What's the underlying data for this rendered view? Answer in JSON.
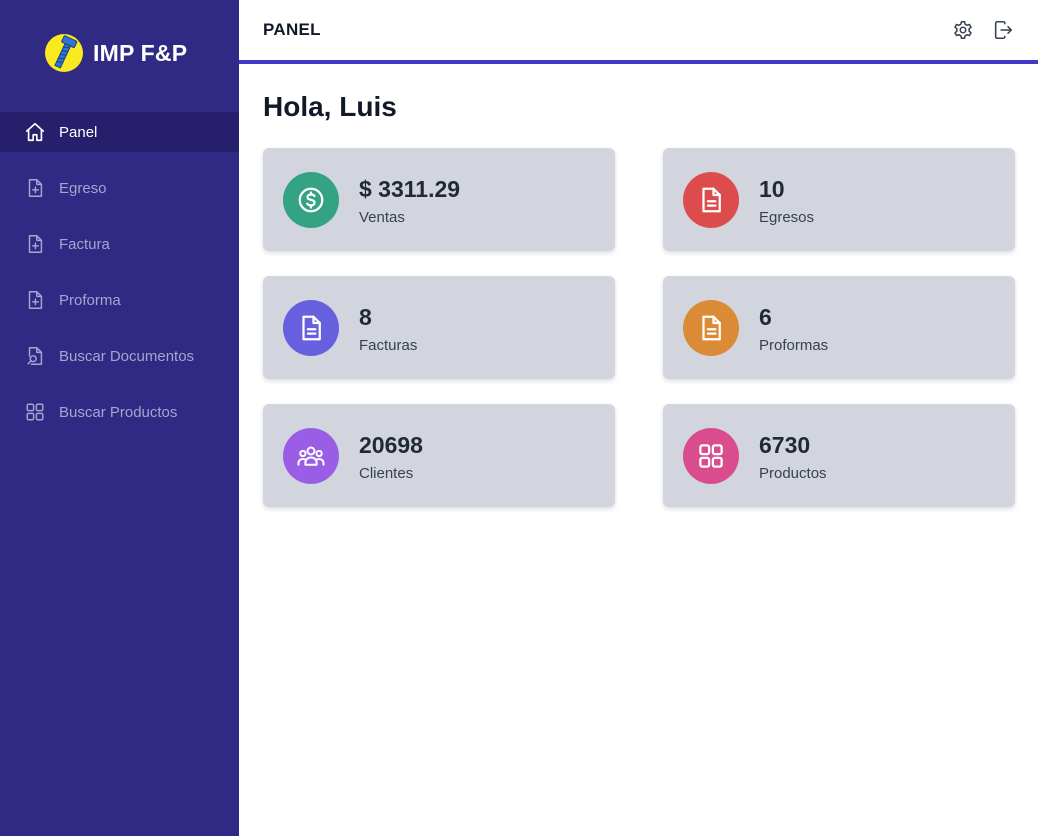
{
  "brand": {
    "name": "IMP F&P"
  },
  "sidebar": {
    "items": [
      {
        "label": "Panel",
        "icon": "home-icon"
      },
      {
        "label": "Egreso",
        "icon": "document-plus-icon"
      },
      {
        "label": "Factura",
        "icon": "document-plus-icon"
      },
      {
        "label": "Proforma",
        "icon": "document-plus-icon"
      },
      {
        "label": "Buscar Documentos",
        "icon": "document-search-icon"
      },
      {
        "label": "Buscar Productos",
        "icon": "grid-icon"
      }
    ]
  },
  "header": {
    "title": "PANEL",
    "icons": [
      "gear-icon",
      "logout-icon"
    ]
  },
  "main": {
    "greeting": "Hola, Luis",
    "cards": [
      {
        "value": "$ 3311.29",
        "label": "Ventas",
        "color": "#34a383",
        "icon": "dollar-icon"
      },
      {
        "value": "10",
        "label": "Egresos",
        "color": "#dc4c4c",
        "icon": "document-icon"
      },
      {
        "value": "8",
        "label": "Facturas",
        "color": "#6760de",
        "icon": "document-icon"
      },
      {
        "value": "6",
        "label": "Proformas",
        "color": "#db8b35",
        "icon": "document-icon"
      },
      {
        "value": "20698",
        "label": "Clientes",
        "color": "#9a5ee6",
        "icon": "users-icon"
      },
      {
        "value": "6730",
        "label": "Productos",
        "color": "#d94d8e",
        "icon": "grid-icon"
      }
    ]
  },
  "colors": {
    "sidebar": "#312a85",
    "sidebar_active": "#271f6c",
    "accent": "#4338ca",
    "card": "#d2d5dd"
  }
}
